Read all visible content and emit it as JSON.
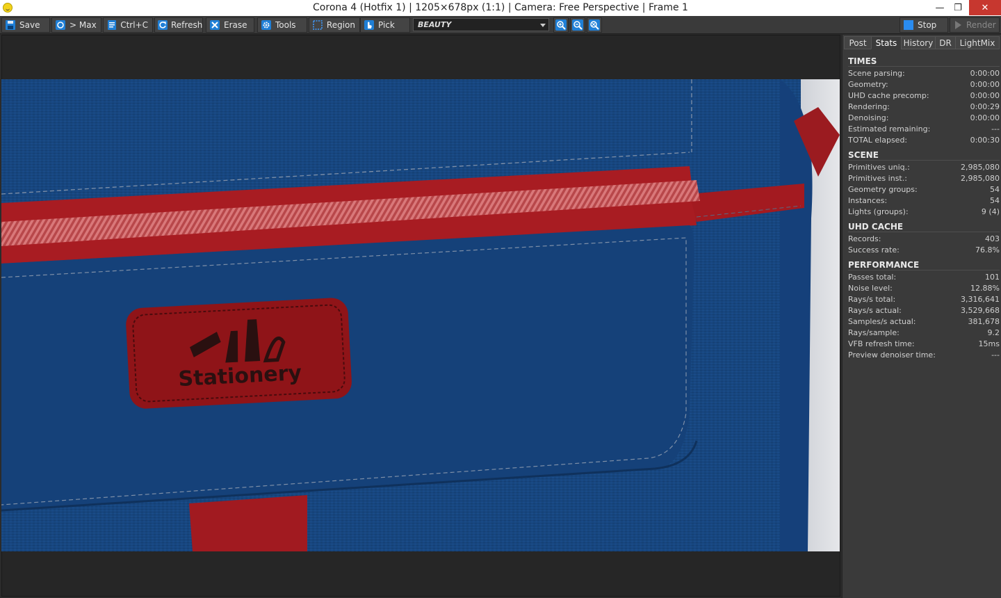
{
  "window": {
    "title": "Corona 4 (Hotfix 1) | 1205×678px (1:1) | Camera: Free Perspective | Frame 1",
    "minimize": "—",
    "maximize": "❐",
    "close": "✕"
  },
  "toolbar": {
    "save": "Save",
    "max": "> Max",
    "copy": "Ctrl+C",
    "refresh": "Refresh",
    "erase": "Erase",
    "tools": "Tools",
    "region": "Region",
    "pick": "Pick",
    "render_element": "BEAUTY",
    "stop": "Stop",
    "render": "Render"
  },
  "render_image": {
    "label_text": "Stationery"
  },
  "tabs": [
    "Post",
    "Stats",
    "History",
    "DR",
    "LightMix"
  ],
  "active_tab": "Stats",
  "stats": {
    "times": {
      "title": "TIMES",
      "rows": [
        {
          "k": "Scene parsing:",
          "v": "0:00:00"
        },
        {
          "k": "Geometry:",
          "v": "0:00:00"
        },
        {
          "k": "UHD cache precomp:",
          "v": "0:00:00"
        },
        {
          "k": "Rendering:",
          "v": "0:00:29"
        },
        {
          "k": "Denoising:",
          "v": "0:00:00"
        },
        {
          "k": "Estimated remaining:",
          "v": "---"
        },
        {
          "k": "TOTAL elapsed:",
          "v": "0:00:30"
        }
      ]
    },
    "scene": {
      "title": "SCENE",
      "rows": [
        {
          "k": "Primitives uniq.:",
          "v": "2,985,080"
        },
        {
          "k": "Primitives inst.:",
          "v": "2,985,080"
        },
        {
          "k": "Geometry groups:",
          "v": "54"
        },
        {
          "k": "Instances:",
          "v": "54"
        },
        {
          "k": "Lights (groups):",
          "v": "9 (4)"
        }
      ]
    },
    "uhd": {
      "title": "UHD CACHE",
      "rows": [
        {
          "k": "Records:",
          "v": "403"
        },
        {
          "k": "Success rate:",
          "v": "76.8%"
        }
      ]
    },
    "performance": {
      "title": "PERFORMANCE",
      "rows": [
        {
          "k": "Passes total:",
          "v": "101"
        },
        {
          "k": "Noise level:",
          "v": "12.88%"
        },
        {
          "k": "Rays/s total:",
          "v": "3,316,641"
        },
        {
          "k": "Rays/s actual:",
          "v": "3,529,668"
        },
        {
          "k": "Samples/s actual:",
          "v": "381,678"
        },
        {
          "k": "Rays/sample:",
          "v": "9.2"
        },
        {
          "k": "VFB refresh time:",
          "v": "15ms"
        },
        {
          "k": "Preview denoiser time:",
          "v": "---"
        }
      ]
    }
  }
}
